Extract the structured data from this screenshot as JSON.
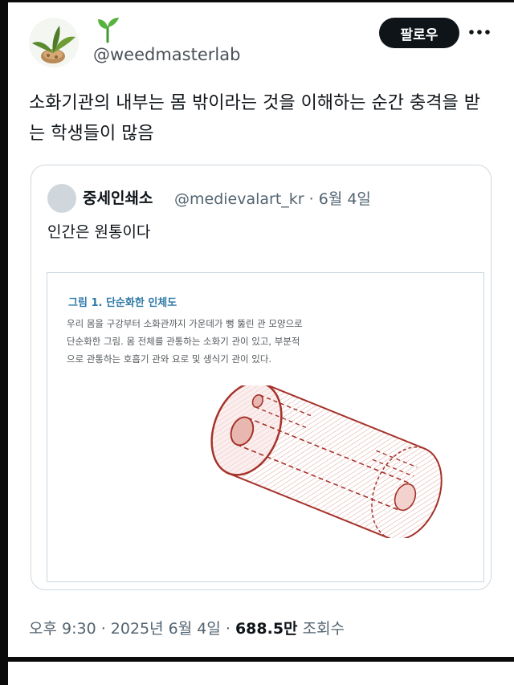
{
  "post": {
    "handle": "@weedmasterlab",
    "follow_label": "팔로우",
    "text": "소화기관의 내부는 몸 밖이라는 것을 이해하는 순간 충격을 받는 학생들이 많음"
  },
  "quote": {
    "name": "중세인쇄소",
    "handle_date": "@medievalart_kr · 6월 4일",
    "text": "인간은 원통이다",
    "figure": {
      "title": "그림 1. 단순화한 인체도",
      "line1": "우리 몸을 구강부터 소화관까지 가운데가 뻥 뚫린 관 모양으로",
      "line2": "단순화한 그림. 몸 전체를 관통하는 소화기 관이 있고, 부분적",
      "line3": "으로 관통하는 호흡기 관와 요로 및 생식기 관이 있다."
    }
  },
  "meta": {
    "time": "오후 9:30 · 2025년 6월 4일 · ",
    "views_count": "688.5만",
    "views_label": " 조회수"
  },
  "icons": {
    "more": "more-horizontal-icon",
    "sprout": "sprout-icon"
  },
  "colors": {
    "follow_bg": "#0f1419",
    "figure_title": "#2f79a6",
    "tube_stroke": "#a5322a"
  }
}
